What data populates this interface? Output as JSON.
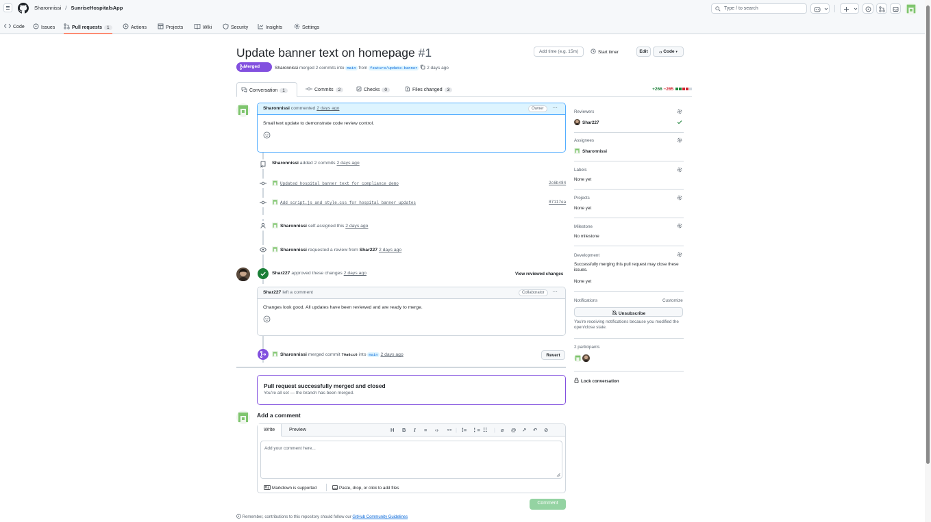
{
  "header": {
    "owner": "Sharonnissi",
    "separator": "/",
    "repo": "SunriseHospitalsApp",
    "search_placeholder": "Type / to search"
  },
  "repo_nav": {
    "tabs": [
      {
        "label": "Code",
        "icon": "code-icon"
      },
      {
        "label": "Issues",
        "icon": "issue-icon"
      },
      {
        "label": "Pull requests",
        "icon": "pull-request-icon",
        "count": "1",
        "active": true
      },
      {
        "label": "Actions",
        "icon": "play-icon"
      },
      {
        "label": "Projects",
        "icon": "table-icon"
      },
      {
        "label": "Wiki",
        "icon": "book-icon"
      },
      {
        "label": "Security",
        "icon": "shield-icon"
      },
      {
        "label": "Insights",
        "icon": "graph-icon"
      },
      {
        "label": "Settings",
        "icon": "gear-icon"
      }
    ]
  },
  "pr": {
    "title": "Update banner text on homepage",
    "number": "#1",
    "status": "Merged",
    "author": "Sharonnissi",
    "merge_text": "merged 2 commits into",
    "base_branch": "main",
    "from": "from",
    "head_branch": "feature/update-banner",
    "time": "2 days ago",
    "add_time_placeholder": "Add time (e.g. 15m)",
    "start_timer": "Start timer",
    "edit": "Edit",
    "code": "Code"
  },
  "pr_tabs": [
    {
      "label": "Conversation",
      "count": "1"
    },
    {
      "label": "Commits",
      "count": "2"
    },
    {
      "label": "Checks",
      "count": "0"
    },
    {
      "label": "Files changed",
      "count": "3"
    }
  ],
  "diffstat": {
    "additions": "+266",
    "deletions": "−265"
  },
  "timeline": {
    "first_comment": {
      "author": "Sharonnissi",
      "action": "commented",
      "time": "2 days ago",
      "badge": "Owner",
      "body": "Small text update to demonstrate code review control."
    },
    "added_commits": {
      "author": "Sharonnissi",
      "action": "added 2 commits",
      "time": "2 days ago"
    },
    "commits": [
      {
        "message": "Updated hospital banner text for compliance demo",
        "sha": "2c6b484"
      },
      {
        "message": "Add script.js and style.css for hospital banner updates",
        "sha": "87117ea"
      }
    ],
    "self_assigned": {
      "author": "Sharonnissi",
      "action": "self-assigned this",
      "time": "2 days ago"
    },
    "review_request": {
      "author": "Sharonnissi",
      "action": "requested a review from",
      "reviewer": "Shar227",
      "time": "2 days ago"
    },
    "approval": {
      "author": "Shar227",
      "action": "approved these changes",
      "time": "2 days ago",
      "view_link": "View reviewed changes"
    },
    "review_comment": {
      "author": "Shar227",
      "action": "left a comment",
      "badge": "Collaborator",
      "body": "Changes look good. All updates have been reviewed and are ready to merge."
    },
    "merge_event": {
      "author": "Sharonnissi",
      "action": "merged commit",
      "sha": "70a6cc6",
      "into": "into",
      "branch": "main",
      "time": "2 days ago",
      "revert": "Revert"
    }
  },
  "merged_box": {
    "heading": "Pull request successfully merged and closed",
    "sub": "You're all set — the branch has been merged."
  },
  "comment_form": {
    "heading": "Add a comment",
    "write_tab": "Write",
    "preview_tab": "Preview",
    "placeholder": "Add your comment here...",
    "markdown_note": "Markdown is supported",
    "attach_note": "Paste, drop, or click to add files",
    "submit": "Comment",
    "remember_prefix": "Remember, contributions to this repository should follow our",
    "guidelines_link": "GitHub Community Guidelines"
  },
  "sidebar": {
    "reviewers": {
      "heading": "Reviewers",
      "name": "Shar227"
    },
    "assignees": {
      "heading": "Assignees",
      "name": "Sharonnissi"
    },
    "labels": {
      "heading": "Labels",
      "value": "None yet"
    },
    "projects": {
      "heading": "Projects",
      "value": "None yet"
    },
    "milestone": {
      "heading": "Milestone",
      "value": "No milestone"
    },
    "development": {
      "heading": "Development",
      "note": "Successfully merging this pull request may close these issues.",
      "value": "None yet"
    },
    "notifications": {
      "heading": "Notifications",
      "customize": "Customize",
      "button": "Unsubscribe",
      "note": "You're receiving notifications because you modified the open/close state."
    },
    "participants": {
      "heading": "2 participants"
    },
    "lock": "Lock conversation"
  },
  "colors": {
    "merged": "#8250df",
    "approved": "#1a7f37",
    "accent_link": "#0969da",
    "tab_underline": "#fd8c73"
  }
}
